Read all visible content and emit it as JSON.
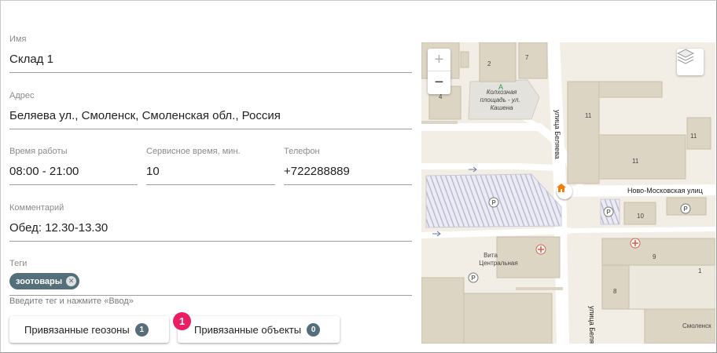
{
  "form": {
    "name": {
      "label": "Имя",
      "value": "Склад 1"
    },
    "address": {
      "label": "Адрес",
      "value": "Беляева ул., Смоленск, Смоленская обл., Россия"
    },
    "hours": {
      "label": "Время работы",
      "value": "08:00 - 21:00"
    },
    "service_time": {
      "label": "Сервисное время, мин.",
      "value": "10"
    },
    "phone": {
      "label": "Телефон",
      "value": "+722288889"
    },
    "comment": {
      "label": "Комментарий",
      "value": "Обед: 12.30-13.30"
    },
    "tags": {
      "label": "Теги",
      "items": [
        "зоотовары"
      ],
      "hint": "Введите тег и нажмите «Ввод»"
    }
  },
  "buttons": {
    "geozones": {
      "label": "Привязанные геозоны",
      "count": "1"
    },
    "objects": {
      "label": "Привязанные объекты",
      "count": "0"
    }
  },
  "marker": "1",
  "map": {
    "zoom_in": "+",
    "zoom_out": "−",
    "labels": {
      "square": "Колхозная площадь - ул. Кашена",
      "street_belyaeva": "улица Беляева",
      "street_novomoskovskaya": "Ново-Московская улиц",
      "pharmacy": "Вита Центральная",
      "smolensk": "Смоленск",
      "num_2": "2",
      "num_7": "7",
      "num_4": "4",
      "num_11a": "11",
      "num_11b": "11",
      "num_11c": "11",
      "num_10": "10",
      "num_9": "9",
      "num_8": "8",
      "num_1": "1",
      "parking": "P"
    },
    "colors": {
      "background": "#f2eee6",
      "building": "#ddd5c4",
      "road": "#ffffff",
      "parking_hatch": "#b8bbd6",
      "home_marker": "#f57c00"
    }
  }
}
